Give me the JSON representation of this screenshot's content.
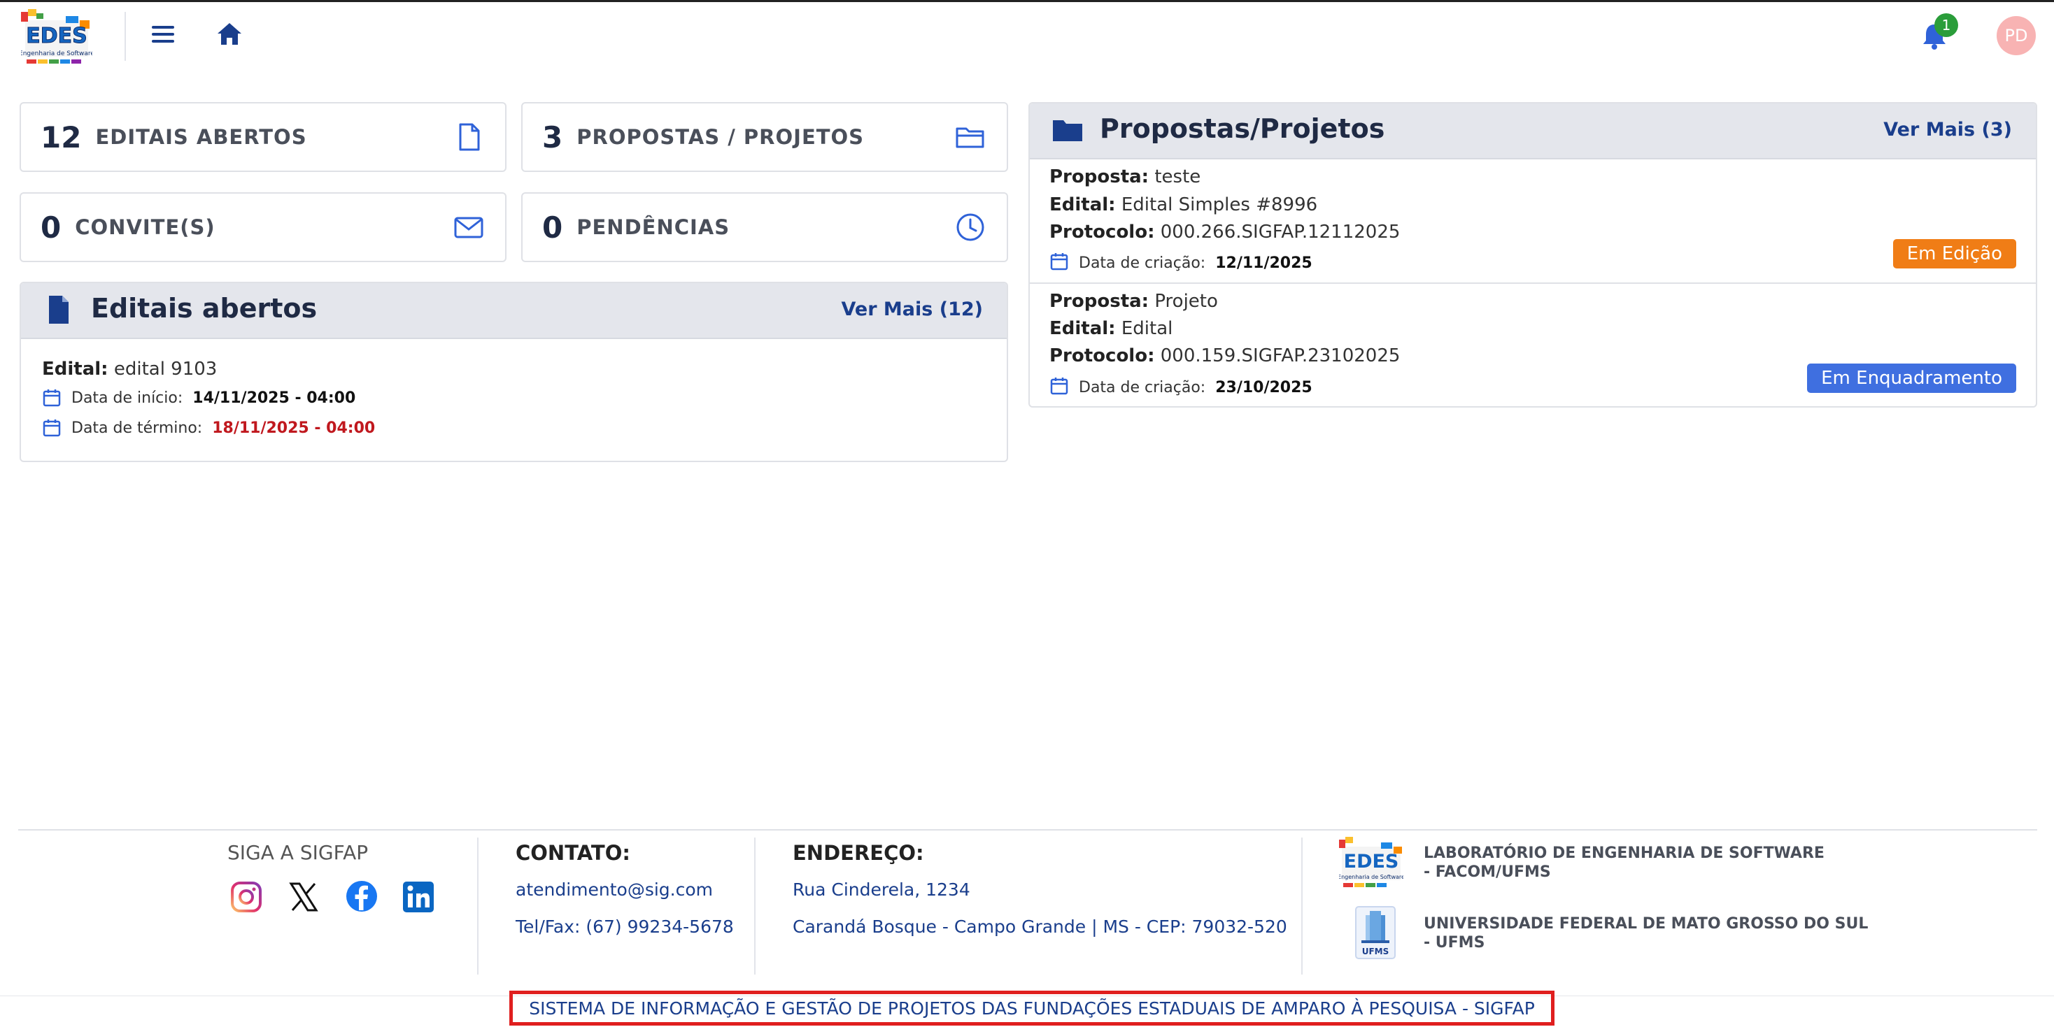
{
  "header": {
    "logo_text": "EDES",
    "logo_subtext": "Engenharia de Software",
    "notifications_count": "1",
    "avatar_initials": "PD"
  },
  "stats": [
    {
      "count": "12",
      "label": "EDITAIS ABERTOS",
      "icon": "file-icon"
    },
    {
      "count": "3",
      "label": "PROPOSTAS / PROJETOS",
      "icon": "folder-open-icon"
    },
    {
      "count": "0",
      "label": "CONVITE(S)",
      "icon": "envelope-icon"
    },
    {
      "count": "0",
      "label": "PENDÊNCIAS",
      "icon": "clock-icon"
    }
  ],
  "editais_panel": {
    "title": "Editais abertos",
    "more_label": "Ver Mais (12)",
    "items": [
      {
        "edital_label": "Edital:",
        "edital_value": "edital 9103",
        "inicio_label": "Data de início:",
        "inicio_value": "14/11/2025 - 04:00",
        "termino_label": "Data de término:",
        "termino_value": "18/11/2025 - 04:00"
      }
    ]
  },
  "propostas_panel": {
    "title": "Propostas/Projetos",
    "more_label": "Ver Mais (3)",
    "items": [
      {
        "proposta_label": "Proposta:",
        "proposta_value": "teste",
        "edital_label": "Edital:",
        "edital_value": "Edital Simples #8996",
        "protocolo_label": "Protocolo:",
        "protocolo_value": "000.266.SIGFAP.12112025",
        "criacao_label": "Data de criação:",
        "criacao_value": "12/11/2025",
        "status": "Em Edição",
        "status_color": "#f07d16"
      },
      {
        "proposta_label": "Proposta:",
        "proposta_value": "Projeto",
        "edital_label": "Edital:",
        "edital_value": "Edital",
        "protocolo_label": "Protocolo:",
        "protocolo_value": "000.159.SIGFAP.23102025",
        "criacao_label": "Data de criação:",
        "criacao_value": "23/10/2025",
        "status": "Em Enquadramento",
        "status_color": "#3f6fe0"
      }
    ]
  },
  "footer": {
    "follow_title": "SIGA A SIGFAP",
    "contact_title": "CONTATO:",
    "email": "atendimento@sig.com",
    "phone": "Tel/Fax: (67) 99234-5678",
    "address_title": "ENDEREÇO:",
    "street": "Rua Cinderela, 1234",
    "city": "Carandá Bosque - Campo Grande | MS - CEP: 79032-520",
    "lab_line1": "LABORATÓRIO DE ENGENHARIA DE SOFTWARE",
    "lab_line2": "- FACOM/UFMS",
    "univ_line1": "UNIVERSIDADE FEDERAL DE MATO GROSSO DO SUL",
    "univ_line2": "- UFMS",
    "univ_logo_text": "UFMS",
    "system_name": "SISTEMA DE INFORMAÇÃO E GESTÃO DE PROJETOS DAS FUNDAÇÕES ESTADUAIS DE AMPARO À PESQUISA - SIGFAP"
  },
  "colors": {
    "primary": "#1a3e8c",
    "danger": "#c0181e",
    "badge_green": "#2a9d3a"
  }
}
